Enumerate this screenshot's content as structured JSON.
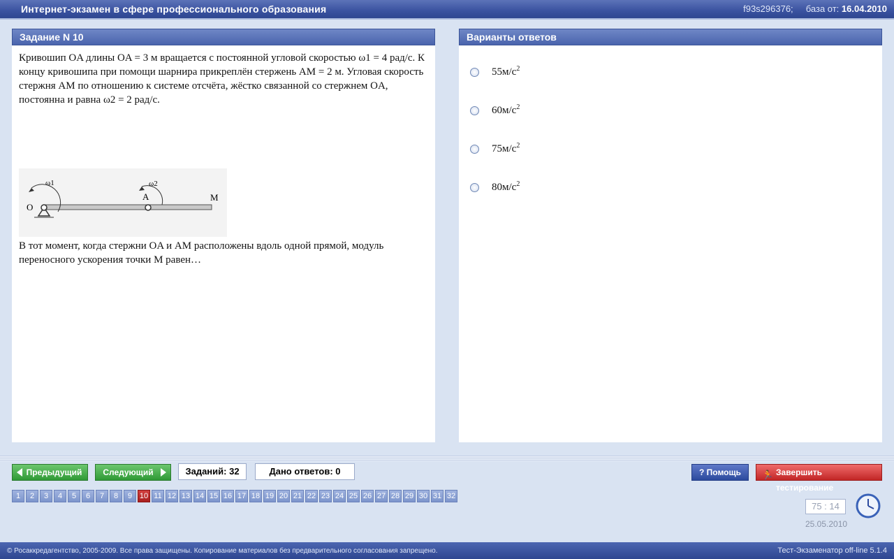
{
  "window": {
    "title": "Интернет-экзамен в сфере профессионального образования",
    "session_id": "f93s296376;",
    "base_label": "база от:",
    "base_date": "16.04.2010"
  },
  "task": {
    "header": "Задание N 10",
    "text_lines": [
      "Кривошип OA длины OA = 3 м вращается с постоянной угловой скоростью ω1 = 4 рад/с. К",
      "концу кривошипа при помощи шарнира прикреплён стержень AM = 2 м. Угловая скорость",
      "стержня AM по отношению к системе отсчёта, жёстко связанной со стержнем OA,",
      "постоянна и равна ω2 = 2 рад/с."
    ],
    "figure_labels": {
      "o": "O",
      "a": "A",
      "m": "M",
      "w1": "ω1",
      "w2": "ω2"
    },
    "question_lines": [
      "В тот момент, когда стержни OA и AM расположены вдоль одной прямой, модуль",
      "переносного ускорения точки M равен…"
    ]
  },
  "answers": {
    "header": "Варианты ответов",
    "unit": "м/с",
    "unit_power": "2",
    "options": [
      "55",
      "60",
      "75",
      "80"
    ]
  },
  "nav": {
    "prev_label": "Предыдущий",
    "next_label": "Следующий",
    "tasks_total": "Заданий: 32",
    "answers_given": "Дано ответов: 0",
    "help_label": "Помощь",
    "finish_label": "Завершить тестирование",
    "current_page": 10,
    "pages": [
      "1",
      "2",
      "3",
      "4",
      "5",
      "6",
      "7",
      "8",
      "9",
      "10",
      "11",
      "12",
      "13",
      "14",
      "15",
      "16",
      "17",
      "18",
      "19",
      "20",
      "21",
      "22",
      "23",
      "24",
      "25",
      "26",
      "27",
      "28",
      "29",
      "30",
      "31",
      "32"
    ]
  },
  "timer": {
    "value": "75 : 14",
    "date": "25.05.2010"
  },
  "footer": {
    "copyright": "© Росаккредагентство, 2005-2009. Все права защищены. Копирование материалов без предварительного согласования запрещено.",
    "version": "Тест-Экзаменатор off-line 5.1.4"
  },
  "colors": {
    "accent": "#3a52a0",
    "current_page": "#c22626",
    "green": "#2f9a36"
  }
}
